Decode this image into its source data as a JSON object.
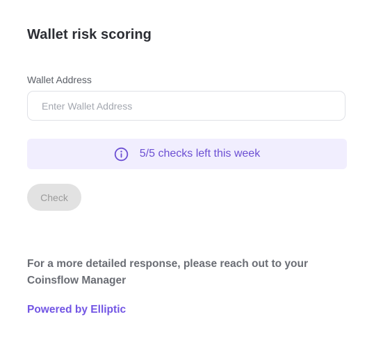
{
  "header": {
    "title": "Wallet risk scoring"
  },
  "form": {
    "address_label": "Wallet Address",
    "address_placeholder": "Enter Wallet Address",
    "address_value": "",
    "check_label": "Check"
  },
  "notice": {
    "icon": "info-icon",
    "text": "5/5 checks left this week"
  },
  "footer": {
    "detail_text": "For a more detailed response, please reach out to your Coinsflow Manager",
    "powered_by": "Powered by Elliptic"
  },
  "colors": {
    "accent": "#7255e4",
    "notice_bg": "#f1eefe",
    "disabled_button": "#e2e2e2"
  }
}
